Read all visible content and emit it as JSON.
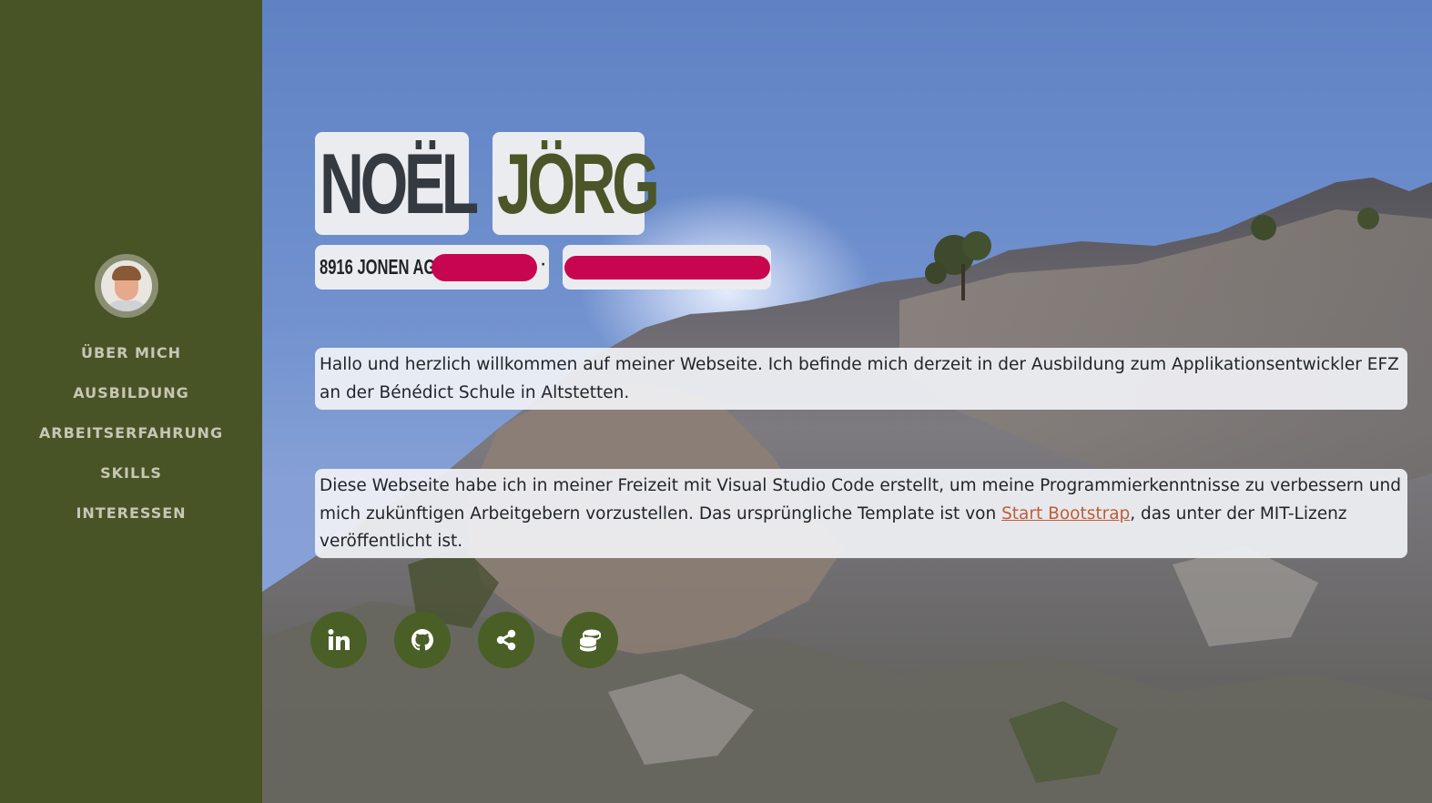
{
  "sidebar": {
    "avatar": "profile-photo",
    "nav": [
      {
        "label": "ÜBER MICH"
      },
      {
        "label": "AUSBILDUNG"
      },
      {
        "label": "ARBEITSERFAHRUNG"
      },
      {
        "label": "SKILLS"
      },
      {
        "label": "INTERESSEN"
      }
    ]
  },
  "hero": {
    "first_name": "NOËL",
    "last_name": "JÖRG",
    "address": "8916 JONEN AG",
    "intro": "Hallo und herzlich willkommen auf meiner Webseite. Ich befinde mich derzeit in der Ausbildung zum Applikationsentwickler EFZ an der Bénédict Schule in Altstetten.",
    "about_before": "Diese Webseite habe ich in meiner Freizeit mit Visual Studio Code erstellt, um meine Programmierkenntnisse zu verbessern und mich zukünftigen Arbeitgebern vorzustellen. Das ursprüngliche Template ist von ",
    "about_link": "Start Bootstrap",
    "about_after": ", das unter der MIT-Lizenz veröffentlicht ist."
  },
  "social": [
    {
      "icon": "linkedin-icon"
    },
    {
      "icon": "github-icon"
    },
    {
      "icon": "share-icon"
    },
    {
      "icon": "database-icon"
    }
  ],
  "colors": {
    "sidebar": "#485326",
    "nav_text": "#c6c7b4",
    "accent_name": "#4a5628",
    "link": "#bd5d38",
    "social_bg": "#4a5f26",
    "redaction": "#c8064f"
  }
}
